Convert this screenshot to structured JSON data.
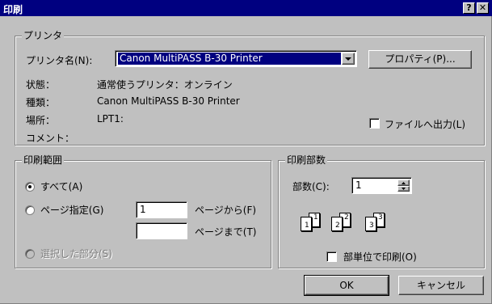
{
  "window": {
    "title": "印刷",
    "help_label": "?",
    "close_label": "✕"
  },
  "printer": {
    "group_label": "プリンタ",
    "name_label": "プリンタ名(N):",
    "name_value": "Canon MultiPASS B-30 Printer",
    "properties_button": "プロパティ(P)...",
    "status_label": "状態：",
    "status_value": "通常使うプリンタ：オンライン",
    "type_label": "種類：",
    "type_value": "Canon MultiPASS B-30 Printer",
    "where_label": "場所：",
    "where_value": "LPT1:",
    "comment_label": "コメント：",
    "print_to_file_label": "ファイルへ出力(L)",
    "print_to_file_checked": false
  },
  "range": {
    "group_label": "印刷範囲",
    "all_label": "すべて(A)",
    "pages_label": "ページ指定(G)",
    "from_value": "1",
    "from_label": "ページから(F)",
    "to_value": "",
    "to_label": "ページまで(T)",
    "selection_label": "選択した部分(S)",
    "selected": "all"
  },
  "copies": {
    "group_label": "印刷部数",
    "count_label": "部数(C):",
    "count_value": "1",
    "collate_label": "部単位で印刷(O)",
    "collate_checked": false,
    "page_numbers": [
      "1",
      "1",
      "2",
      "2",
      "3",
      "3"
    ]
  },
  "buttons": {
    "ok": "OK",
    "cancel": "キャンセル"
  }
}
